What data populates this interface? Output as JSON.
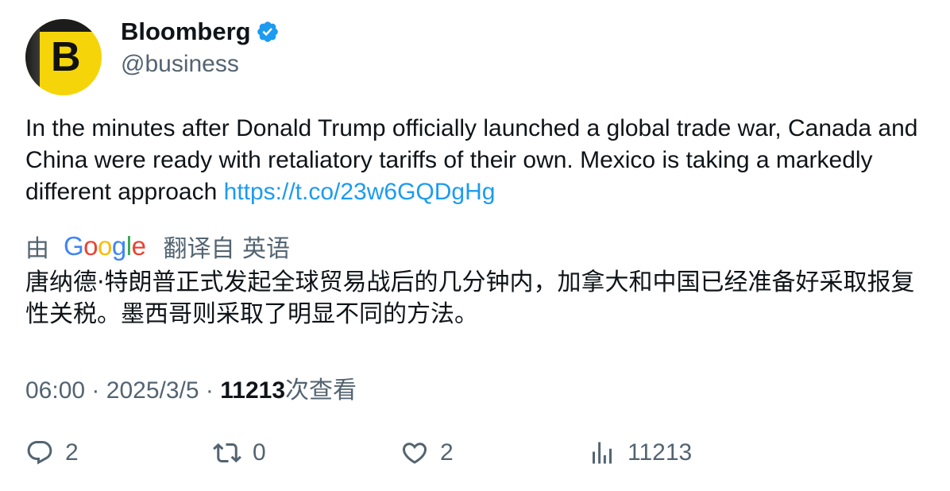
{
  "author": {
    "name": "Bloomberg",
    "handle": "@business",
    "avatar_letter": "B",
    "verified": true
  },
  "tweet": {
    "text": "In the minutes after Donald Trump officially launched a global trade war, Canada and China were ready with retaliatory tariffs of their own. Mexico is taking a markedly different approach",
    "link": "https://t.co/23w6GQDgHg"
  },
  "translation": {
    "prefix": "由",
    "provider": "Google",
    "label": "翻译自 英语",
    "text": "唐纳德·特朗普正式发起全球贸易战后的几分钟内，加拿大和中国已经准备好采取报复性关税。墨西哥则采取了明显不同的方法。"
  },
  "meta": {
    "time": "06:00",
    "separator": "·",
    "date": "2025/3/5",
    "views_count": "11213",
    "views_label": "次查看"
  },
  "actions": {
    "replies": "2",
    "retweets": "0",
    "likes": "2",
    "views": "11213"
  },
  "colors": {
    "link": "#1d9bf0",
    "secondary": "#536471",
    "verified": "#1d9bf0",
    "avatar": "#f5d50a"
  }
}
